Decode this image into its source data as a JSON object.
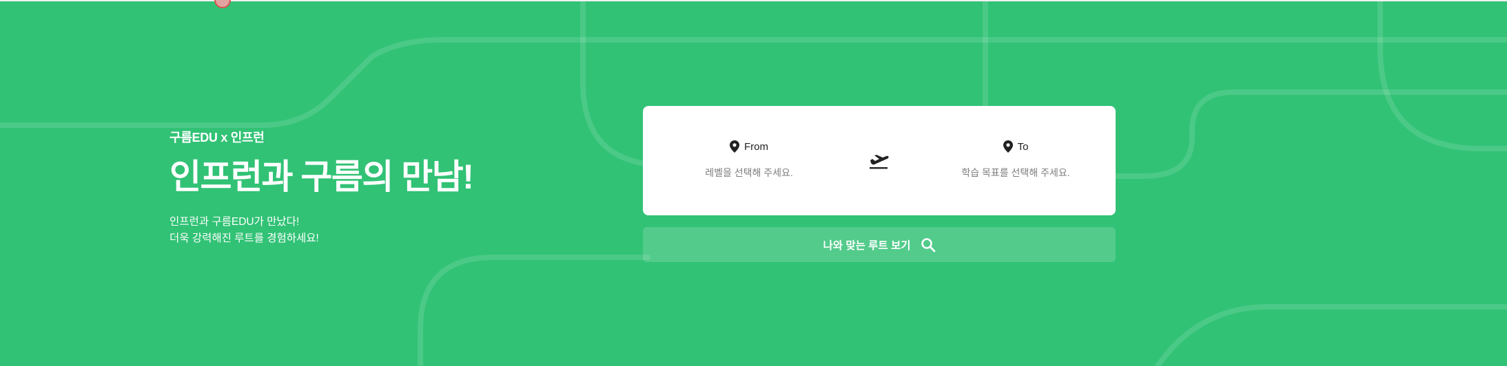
{
  "hero": {
    "eyebrow": "구름EDU x 인프런",
    "title": "인프런과 구름의 만남!",
    "description_lines": [
      "인프런과 구름EDU가 만났다!",
      "더욱 강력해진 루트를 경험하세요!"
    ]
  },
  "route_card": {
    "from": {
      "label": "From",
      "placeholder": "레벨을 선택해 주세요."
    },
    "to": {
      "label": "To",
      "placeholder": "학습 목표를 선택해 주세요."
    },
    "swap_icon": "airplane-takeoff-icon"
  },
  "cta": {
    "label": "나와 맞는 루트 보기",
    "icon": "search-icon"
  },
  "colors": {
    "background": "#31c275",
    "card": "#ffffff",
    "pin": "#222222",
    "placeholder": "#7d7d7d"
  }
}
